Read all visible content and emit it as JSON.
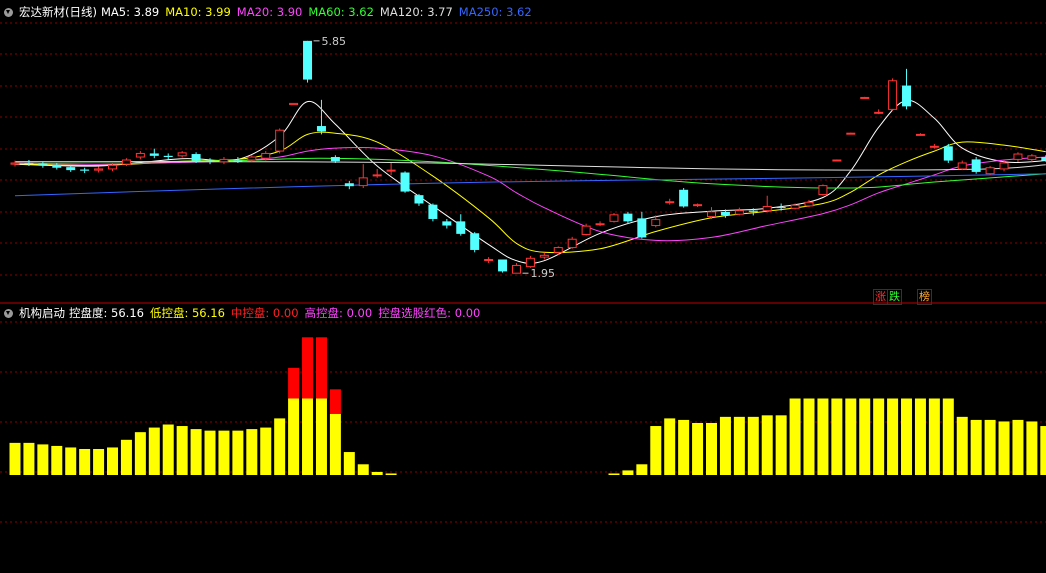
{
  "top_legend": {
    "title": "宏达新材(日线)",
    "items": [
      {
        "text": "MA5: 3.89",
        "color": "#ffffff"
      },
      {
        "text": "MA10: 3.99",
        "color": "#ffff00"
      },
      {
        "text": "MA20: 3.90",
        "color": "#ff44ff"
      },
      {
        "text": "MA60: 3.62",
        "color": "#33ff33"
      },
      {
        "text": "MA120: 3.77",
        "color": "#dddddd"
      },
      {
        "text": "MA250: 3.62",
        "color": "#3366ff"
      }
    ]
  },
  "bottom_legend": {
    "title": "机构启动",
    "items": [
      {
        "text": "控盘度: 56.16",
        "color": "#ffffff"
      },
      {
        "text": "低控盘: 56.16",
        "color": "#ffff00"
      },
      {
        "text": "中控盘: 0.00",
        "color": "#ff2222"
      },
      {
        "text": "高控盘: 0.00",
        "color": "#ff44ff"
      },
      {
        "text": "控盘选股红色: 0.00",
        "color": "#ff44ff"
      }
    ]
  },
  "tags": {
    "zhang": "涨",
    "die": "跌",
    "bang": "榜"
  },
  "colors": {
    "up": "#ff3333",
    "down": "#54ffff",
    "grid": "#8b0000",
    "low_control": "#ffff00",
    "mid_control": "#ff0000",
    "ma5": "#ffffff",
    "ma10": "#ffff00",
    "ma20": "#ff44ff",
    "ma60": "#33ff33",
    "ma120": "#dddddd",
    "ma250": "#3366ff"
  },
  "chart_data": [
    {
      "type": "candlestick",
      "title": "宏达新材(日线)",
      "ylim": [
        1.5,
        6.2
      ],
      "annotations": [
        {
          "text": "5.85",
          "index": 21,
          "value": 5.85
        },
        {
          "text": "1.95",
          "index": 36,
          "value": 1.95
        }
      ],
      "candles": [
        [
          3.78,
          3.8,
          3.84,
          3.74
        ],
        [
          3.8,
          3.79,
          3.85,
          3.75
        ],
        [
          3.79,
          3.77,
          3.83,
          3.72
        ],
        [
          3.77,
          3.72,
          3.8,
          3.69
        ],
        [
          3.73,
          3.68,
          3.76,
          3.65
        ],
        [
          3.69,
          3.67,
          3.72,
          3.63
        ],
        [
          3.68,
          3.7,
          3.74,
          3.64
        ],
        [
          3.7,
          3.76,
          3.8,
          3.66
        ],
        [
          3.78,
          3.85,
          3.88,
          3.75
        ],
        [
          3.9,
          3.96,
          4.0,
          3.86
        ],
        [
          3.96,
          3.92,
          4.04,
          3.88
        ],
        [
          3.92,
          3.9,
          3.96,
          3.86
        ],
        [
          3.92,
          3.97,
          4.0,
          3.89
        ],
        [
          3.95,
          3.84,
          3.98,
          3.8
        ],
        [
          3.84,
          3.82,
          3.88,
          3.78
        ],
        [
          3.82,
          3.86,
          3.9,
          3.78
        ],
        [
          3.84,
          3.83,
          3.9,
          3.8
        ],
        [
          3.85,
          3.9,
          3.93,
          3.82
        ],
        [
          3.88,
          3.96,
          4.0,
          3.84
        ],
        [
          4.0,
          4.35,
          4.38,
          3.96
        ],
        [
          4.78,
          4.8,
          4.8,
          4.78
        ],
        [
          5.85,
          5.2,
          5.85,
          5.15
        ],
        [
          4.42,
          4.33,
          4.86,
          4.28
        ],
        [
          3.9,
          3.83,
          3.93,
          3.8
        ],
        [
          3.46,
          3.41,
          3.5,
          3.36
        ],
        [
          3.42,
          3.55,
          3.78,
          3.38
        ],
        [
          3.6,
          3.6,
          3.7,
          3.55
        ],
        [
          3.68,
          3.68,
          3.8,
          3.6
        ],
        [
          3.64,
          3.32,
          3.66,
          3.3
        ],
        [
          3.26,
          3.12,
          3.28,
          3.08
        ],
        [
          3.1,
          2.86,
          3.12,
          2.82
        ],
        [
          2.82,
          2.75,
          2.86,
          2.7
        ],
        [
          2.82,
          2.61,
          2.94,
          2.58
        ],
        [
          2.62,
          2.34,
          2.64,
          2.3
        ],
        [
          2.18,
          2.18,
          2.22,
          2.12
        ],
        [
          2.18,
          1.98,
          2.18,
          1.96
        ],
        [
          1.95,
          2.08,
          2.12,
          1.95
        ],
        [
          2.06,
          2.2,
          2.24,
          2.04
        ],
        [
          2.22,
          2.25,
          2.3,
          2.18
        ],
        [
          2.3,
          2.38,
          2.4,
          2.26
        ],
        [
          2.38,
          2.52,
          2.56,
          2.36
        ],
        [
          2.6,
          2.74,
          2.78,
          2.58
        ],
        [
          2.78,
          2.78,
          2.82,
          2.74
        ],
        [
          2.82,
          2.93,
          2.96,
          2.8
        ],
        [
          2.95,
          2.82,
          2.98,
          2.78
        ],
        [
          2.87,
          2.55,
          2.98,
          2.53
        ],
        [
          2.75,
          2.85,
          2.92,
          2.72
        ],
        [
          3.15,
          3.15,
          3.2,
          3.1
        ],
        [
          3.35,
          3.07,
          3.38,
          3.05
        ],
        [
          3.1,
          3.1,
          3.12,
          3.06
        ],
        [
          2.9,
          2.98,
          3.06,
          2.86
        ],
        [
          2.98,
          2.92,
          3.02,
          2.88
        ],
        [
          2.94,
          3.0,
          3.05,
          2.92
        ],
        [
          3.0,
          2.98,
          3.04,
          2.92
        ],
        [
          3.0,
          3.07,
          3.25,
          2.97
        ],
        [
          3.06,
          3.05,
          3.12,
          3.0
        ],
        [
          3.04,
          3.09,
          3.12,
          3.02
        ],
        [
          3.08,
          3.14,
          3.18,
          3.06
        ],
        [
          3.27,
          3.42,
          3.44,
          3.25
        ],
        [
          3.85,
          3.85,
          3.86,
          3.84
        ],
        [
          4.3,
          4.3,
          4.31,
          4.29
        ],
        [
          4.9,
          4.9,
          4.91,
          4.89
        ],
        [
          4.65,
          4.65,
          4.7,
          4.62
        ],
        [
          4.7,
          5.18,
          5.22,
          4.68
        ],
        [
          5.1,
          4.75,
          5.38,
          4.7
        ],
        [
          4.28,
          4.28,
          4.3,
          4.26
        ],
        [
          4.08,
          4.08,
          4.12,
          4.04
        ],
        [
          4.08,
          3.84,
          4.12,
          3.8
        ],
        [
          3.7,
          3.8,
          3.84,
          3.68
        ],
        [
          3.86,
          3.65,
          3.9,
          3.62
        ],
        [
          3.62,
          3.72,
          3.75,
          3.6
        ],
        [
          3.7,
          3.8,
          3.84,
          3.66
        ],
        [
          3.86,
          3.95,
          3.98,
          3.82
        ],
        [
          3.86,
          3.92,
          3.95,
          3.82
        ],
        [
          3.9,
          3.84,
          3.93,
          3.82
        ]
      ],
      "series": [
        {
          "name": "MA5",
          "x": [
            0,
            6,
            12,
            16,
            19,
            21,
            23,
            26,
            30,
            34,
            36,
            38,
            42,
            46,
            50,
            54,
            58,
            60,
            62,
            64,
            66,
            68,
            71,
            74
          ],
          "values": [
            3.78,
            3.75,
            3.87,
            3.86,
            4.25,
            4.83,
            4.45,
            3.75,
            3.08,
            2.43,
            2.16,
            2.16,
            2.62,
            2.9,
            2.99,
            3.04,
            3.22,
            3.67,
            4.4,
            4.85,
            4.55,
            4.05,
            3.82,
            3.84
          ]
        },
        {
          "name": "MA10",
          "x": [
            0,
            6,
            12,
            16,
            19,
            21,
            23,
            26,
            30,
            34,
            36,
            38,
            42,
            46,
            50,
            54,
            58,
            60,
            62,
            64,
            66,
            68,
            71,
            74
          ],
          "values": [
            3.79,
            3.76,
            3.83,
            3.86,
            4.0,
            4.28,
            4.3,
            4.15,
            3.58,
            2.88,
            2.45,
            2.3,
            2.36,
            2.65,
            2.88,
            2.99,
            3.12,
            3.31,
            3.6,
            3.82,
            4.0,
            4.15,
            4.1,
            3.99
          ]
        },
        {
          "name": "MA20",
          "x": [
            0,
            6,
            12,
            16,
            19,
            21,
            23,
            26,
            30,
            34,
            36,
            38,
            42,
            46,
            50,
            54,
            58,
            60,
            62,
            64,
            66,
            68,
            71,
            74
          ],
          "values": [
            3.8,
            3.78,
            3.81,
            3.84,
            3.9,
            4.0,
            4.05,
            4.05,
            3.92,
            3.58,
            3.3,
            3.05,
            2.65,
            2.5,
            2.55,
            2.75,
            2.95,
            3.1,
            3.3,
            3.45,
            3.6,
            3.75,
            3.85,
            3.9
          ]
        },
        {
          "name": "MA60",
          "x": [
            0,
            8,
            16,
            22,
            30,
            40,
            50,
            60,
            66,
            74
          ],
          "values": [
            3.82,
            3.82,
            3.84,
            3.88,
            3.82,
            3.65,
            3.45,
            3.38,
            3.48,
            3.62
          ]
        },
        {
          "name": "MA120",
          "x": [
            0,
            10,
            20,
            30,
            40,
            50,
            60,
            70,
            74
          ],
          "values": [
            3.82,
            3.82,
            3.82,
            3.8,
            3.75,
            3.7,
            3.68,
            3.7,
            3.77
          ]
        },
        {
          "name": "MA250",
          "x": [
            0,
            10,
            20,
            30,
            40,
            50,
            60,
            70,
            74
          ],
          "values": [
            3.25,
            3.33,
            3.4,
            3.46,
            3.5,
            3.53,
            3.56,
            3.6,
            3.62
          ]
        }
      ]
    },
    {
      "type": "bar",
      "title": "机构启动",
      "ylim": [
        0,
        100
      ],
      "series": [
        {
          "name": "低控盘",
          "values": [
            21,
            21,
            20,
            19,
            18,
            17,
            17,
            18,
            23,
            28,
            31,
            33,
            32,
            30,
            29,
            29,
            29,
            30,
            31,
            37,
            50,
            50,
            50,
            40,
            15,
            7,
            2,
            1,
            0,
            0,
            0,
            0,
            0,
            0,
            0,
            0,
            0,
            0,
            0,
            0,
            0,
            0,
            0,
            1,
            3,
            7,
            32,
            37,
            36,
            34,
            34,
            38,
            38,
            38,
            39,
            39,
            50,
            50,
            50,
            50,
            50,
            50,
            50,
            50,
            50,
            50,
            50,
            50,
            38,
            36,
            36,
            35,
            36,
            35,
            32
          ]
        },
        {
          "name": "中控盘",
          "values": [
            0,
            0,
            0,
            0,
            0,
            0,
            0,
            0,
            0,
            0,
            0,
            0,
            0,
            0,
            0,
            0,
            0,
            0,
            0,
            0,
            20,
            40,
            40,
            16,
            0,
            0,
            0,
            0,
            0,
            0,
            0,
            0,
            0,
            0,
            0,
            0,
            0,
            0,
            0,
            0,
            0,
            0,
            0,
            0,
            0,
            0,
            0,
            0,
            0,
            0,
            0,
            0,
            0,
            0,
            0,
            0,
            0,
            0,
            0,
            0,
            0,
            0,
            0,
            0,
            0,
            0,
            0,
            0,
            0,
            0,
            0,
            0,
            0,
            0,
            0
          ]
        }
      ]
    }
  ]
}
